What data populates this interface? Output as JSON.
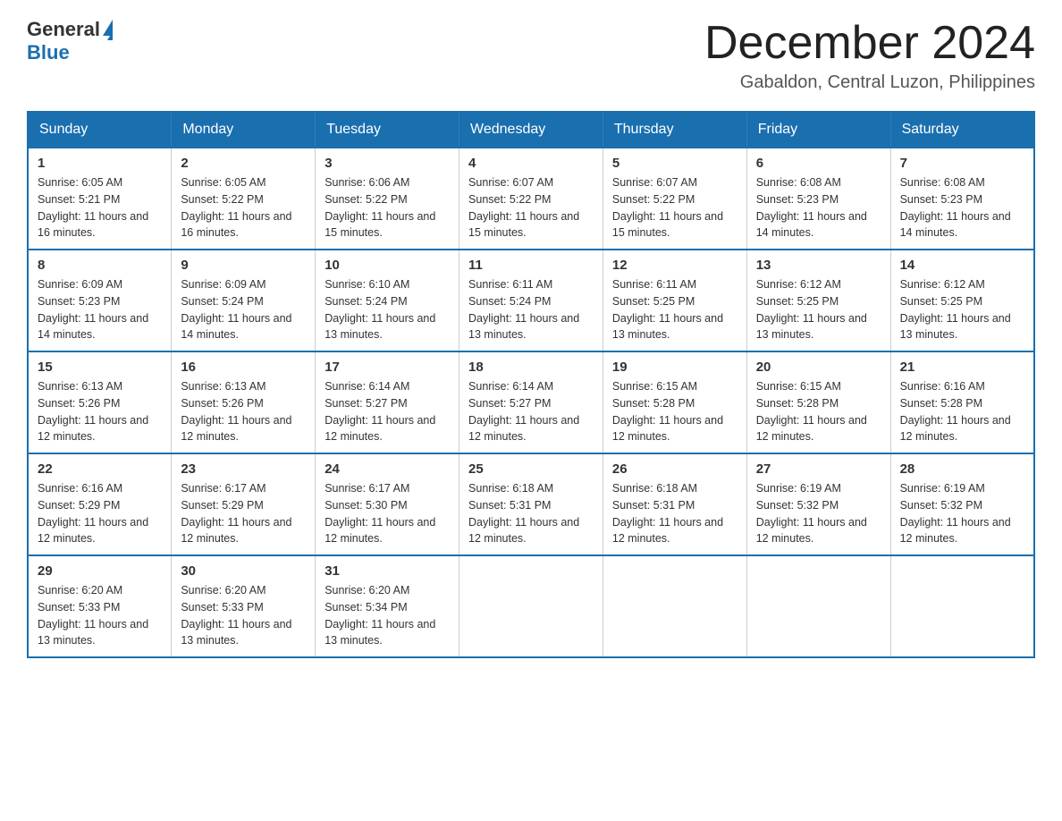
{
  "header": {
    "logo_general": "General",
    "logo_blue": "Blue",
    "month_title": "December 2024",
    "location": "Gabaldon, Central Luzon, Philippines"
  },
  "calendar": {
    "days_of_week": [
      "Sunday",
      "Monday",
      "Tuesday",
      "Wednesday",
      "Thursday",
      "Friday",
      "Saturday"
    ],
    "weeks": [
      [
        {
          "day": "1",
          "sunrise": "6:05 AM",
          "sunset": "5:21 PM",
          "daylight": "11 hours and 16 minutes."
        },
        {
          "day": "2",
          "sunrise": "6:05 AM",
          "sunset": "5:22 PM",
          "daylight": "11 hours and 16 minutes."
        },
        {
          "day": "3",
          "sunrise": "6:06 AM",
          "sunset": "5:22 PM",
          "daylight": "11 hours and 15 minutes."
        },
        {
          "day": "4",
          "sunrise": "6:07 AM",
          "sunset": "5:22 PM",
          "daylight": "11 hours and 15 minutes."
        },
        {
          "day": "5",
          "sunrise": "6:07 AM",
          "sunset": "5:22 PM",
          "daylight": "11 hours and 15 minutes."
        },
        {
          "day": "6",
          "sunrise": "6:08 AM",
          "sunset": "5:23 PM",
          "daylight": "11 hours and 14 minutes."
        },
        {
          "day": "7",
          "sunrise": "6:08 AM",
          "sunset": "5:23 PM",
          "daylight": "11 hours and 14 minutes."
        }
      ],
      [
        {
          "day": "8",
          "sunrise": "6:09 AM",
          "sunset": "5:23 PM",
          "daylight": "11 hours and 14 minutes."
        },
        {
          "day": "9",
          "sunrise": "6:09 AM",
          "sunset": "5:24 PM",
          "daylight": "11 hours and 14 minutes."
        },
        {
          "day": "10",
          "sunrise": "6:10 AM",
          "sunset": "5:24 PM",
          "daylight": "11 hours and 13 minutes."
        },
        {
          "day": "11",
          "sunrise": "6:11 AM",
          "sunset": "5:24 PM",
          "daylight": "11 hours and 13 minutes."
        },
        {
          "day": "12",
          "sunrise": "6:11 AM",
          "sunset": "5:25 PM",
          "daylight": "11 hours and 13 minutes."
        },
        {
          "day": "13",
          "sunrise": "6:12 AM",
          "sunset": "5:25 PM",
          "daylight": "11 hours and 13 minutes."
        },
        {
          "day": "14",
          "sunrise": "6:12 AM",
          "sunset": "5:25 PM",
          "daylight": "11 hours and 13 minutes."
        }
      ],
      [
        {
          "day": "15",
          "sunrise": "6:13 AM",
          "sunset": "5:26 PM",
          "daylight": "11 hours and 12 minutes."
        },
        {
          "day": "16",
          "sunrise": "6:13 AM",
          "sunset": "5:26 PM",
          "daylight": "11 hours and 12 minutes."
        },
        {
          "day": "17",
          "sunrise": "6:14 AM",
          "sunset": "5:27 PM",
          "daylight": "11 hours and 12 minutes."
        },
        {
          "day": "18",
          "sunrise": "6:14 AM",
          "sunset": "5:27 PM",
          "daylight": "11 hours and 12 minutes."
        },
        {
          "day": "19",
          "sunrise": "6:15 AM",
          "sunset": "5:28 PM",
          "daylight": "11 hours and 12 minutes."
        },
        {
          "day": "20",
          "sunrise": "6:15 AM",
          "sunset": "5:28 PM",
          "daylight": "11 hours and 12 minutes."
        },
        {
          "day": "21",
          "sunrise": "6:16 AM",
          "sunset": "5:28 PM",
          "daylight": "11 hours and 12 minutes."
        }
      ],
      [
        {
          "day": "22",
          "sunrise": "6:16 AM",
          "sunset": "5:29 PM",
          "daylight": "11 hours and 12 minutes."
        },
        {
          "day": "23",
          "sunrise": "6:17 AM",
          "sunset": "5:29 PM",
          "daylight": "11 hours and 12 minutes."
        },
        {
          "day": "24",
          "sunrise": "6:17 AM",
          "sunset": "5:30 PM",
          "daylight": "11 hours and 12 minutes."
        },
        {
          "day": "25",
          "sunrise": "6:18 AM",
          "sunset": "5:31 PM",
          "daylight": "11 hours and 12 minutes."
        },
        {
          "day": "26",
          "sunrise": "6:18 AM",
          "sunset": "5:31 PM",
          "daylight": "11 hours and 12 minutes."
        },
        {
          "day": "27",
          "sunrise": "6:19 AM",
          "sunset": "5:32 PM",
          "daylight": "11 hours and 12 minutes."
        },
        {
          "day": "28",
          "sunrise": "6:19 AM",
          "sunset": "5:32 PM",
          "daylight": "11 hours and 12 minutes."
        }
      ],
      [
        {
          "day": "29",
          "sunrise": "6:20 AM",
          "sunset": "5:33 PM",
          "daylight": "11 hours and 13 minutes."
        },
        {
          "day": "30",
          "sunrise": "6:20 AM",
          "sunset": "5:33 PM",
          "daylight": "11 hours and 13 minutes."
        },
        {
          "day": "31",
          "sunrise": "6:20 AM",
          "sunset": "5:34 PM",
          "daylight": "11 hours and 13 minutes."
        },
        null,
        null,
        null,
        null
      ]
    ]
  }
}
